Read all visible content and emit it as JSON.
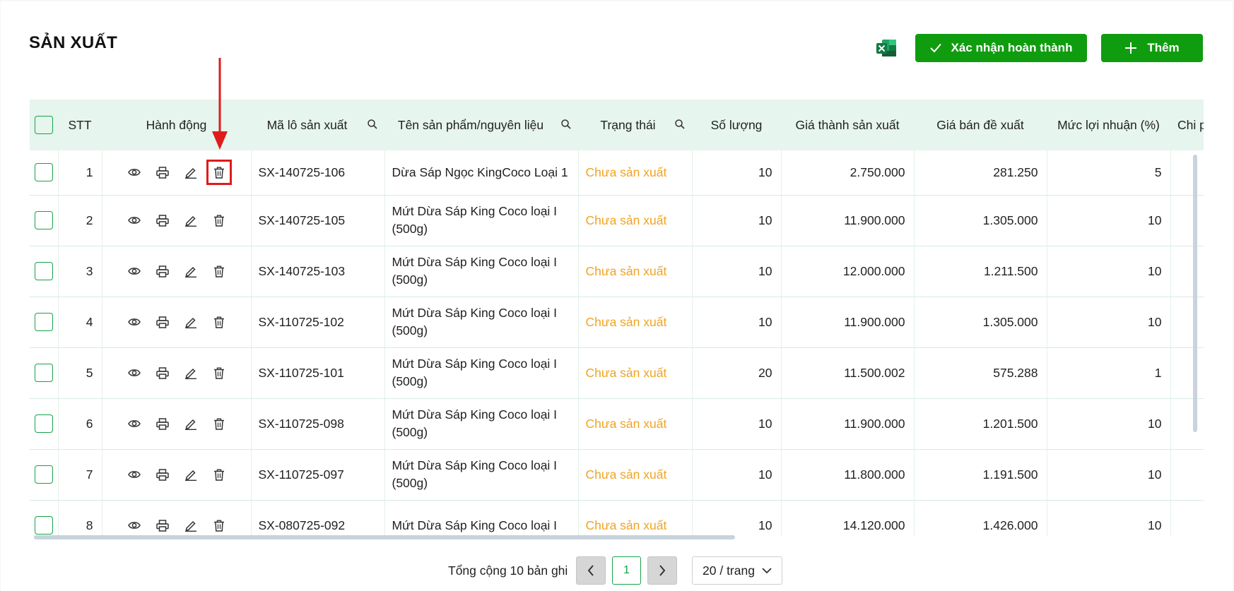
{
  "page": {
    "title": "SẢN XUẤT",
    "buttons": {
      "confirm_label": "Xác nhận hoàn thành",
      "add_label": "Thêm"
    },
    "accent_color": "#0f9d0f",
    "status_color": "#f0a423"
  },
  "table": {
    "headers": {
      "stt": "STT",
      "actions": "Hành động",
      "lot": "Mã lô sản xuất",
      "product": "Tên sản phẩm/nguyên liệu",
      "status": "Trạng thái",
      "quantity": "Số lượng",
      "cost": "Giá thành sản xuất",
      "price": "Giá bán đề xuất",
      "margin": "Mức lợi nhuận (%)",
      "extra": "Chi p"
    },
    "rows": [
      {
        "stt": "1",
        "lot": "SX-140725-106",
        "product": "Dừa Sáp Ngọc KingCoco Loại 1",
        "status": "Chưa sản xuất",
        "quantity": "10",
        "cost": "2.750.000",
        "price": "281.250",
        "margin": "5"
      },
      {
        "stt": "2",
        "lot": "SX-140725-105",
        "product": "Mứt Dừa Sáp King Coco loại I (500g)",
        "status": "Chưa sản xuất",
        "quantity": "10",
        "cost": "11.900.000",
        "price": "1.305.000",
        "margin": "10"
      },
      {
        "stt": "3",
        "lot": "SX-140725-103",
        "product": "Mứt Dừa Sáp King Coco loại I (500g)",
        "status": "Chưa sản xuất",
        "quantity": "10",
        "cost": "12.000.000",
        "price": "1.211.500",
        "margin": "10"
      },
      {
        "stt": "4",
        "lot": "SX-110725-102",
        "product": "Mứt Dừa Sáp King Coco loại I (500g)",
        "status": "Chưa sản xuất",
        "quantity": "10",
        "cost": "11.900.000",
        "price": "1.305.000",
        "margin": "10"
      },
      {
        "stt": "5",
        "lot": "SX-110725-101",
        "product": "Mứt Dừa Sáp King Coco loại I (500g)",
        "status": "Chưa sản xuất",
        "quantity": "20",
        "cost": "11.500.002",
        "price": "575.288",
        "margin": "1"
      },
      {
        "stt": "6",
        "lot": "SX-110725-098",
        "product": "Mứt Dừa Sáp King Coco loại I (500g)",
        "status": "Chưa sản xuất",
        "quantity": "10",
        "cost": "11.900.000",
        "price": "1.201.500",
        "margin": "10"
      },
      {
        "stt": "7",
        "lot": "SX-110725-097",
        "product": "Mứt Dừa Sáp King Coco loại I (500g)",
        "status": "Chưa sản xuất",
        "quantity": "10",
        "cost": "11.800.000",
        "price": "1.191.500",
        "margin": "10"
      },
      {
        "stt": "8",
        "lot": "SX-080725-092",
        "product": "Mứt Dừa Sáp King Coco loại I",
        "status": "Chưa sản xuất",
        "quantity": "10",
        "cost": "14.120.000",
        "price": "1.426.000",
        "margin": "10"
      }
    ]
  },
  "pagination": {
    "total_text": "Tổng cộng 10 bản ghi",
    "current_page": "1",
    "page_size": "20 / trang"
  },
  "icons": [
    "excel-icon",
    "check-icon",
    "plus-icon",
    "search-icon",
    "eye-icon",
    "printer-icon",
    "edit-icon",
    "trash-icon",
    "chevron-left-icon",
    "chevron-right-icon",
    "chevron-down-icon"
  ]
}
